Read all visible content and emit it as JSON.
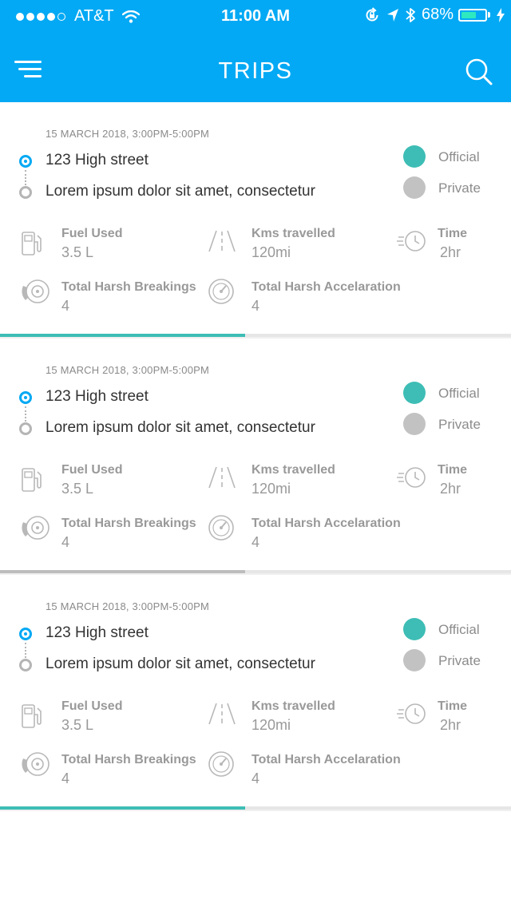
{
  "status_bar": {
    "carrier": "AT&T",
    "time": "11:00 AM",
    "battery": "68%",
    "battery_level": 0.68,
    "signal_bars": 4,
    "icons": [
      "wifi-icon",
      "rotation-lock-icon",
      "location-arrow-icon",
      "bluetooth-icon",
      "battery-icon",
      "charging-bolt-icon"
    ]
  },
  "header": {
    "title": "TRIPS",
    "menu_icon": "menu-icon",
    "search_icon": "search-icon"
  },
  "colors": {
    "primary": "#03a9f4",
    "official": "#3dbdb5",
    "private": "#c2c2c2",
    "text_muted": "#999999"
  },
  "trips": [
    {
      "date": "15 MARCH 2018, 3:00PM-5:00PM",
      "from": "123 High street",
      "to": "Lorem ipsum dolor sit amet, consectetur",
      "categories": {
        "official": "Official",
        "private": "Private"
      },
      "stats": {
        "fuel": {
          "label": "Fuel Used",
          "value": "3.5 L",
          "icon": "fuel-pump-icon"
        },
        "kms": {
          "label": "Kms travelled",
          "value": "120mi",
          "icon": "road-icon"
        },
        "time": {
          "label": "Time",
          "value": "2hr",
          "icon": "fast-clock-icon"
        },
        "braking": {
          "label": "Total Harsh Breakings",
          "value": "4",
          "icon": "brake-disc-icon"
        },
        "accel": {
          "label": "Total Harsh Accelaration",
          "value": "4",
          "icon": "speedometer-icon"
        }
      },
      "progress": 0.48,
      "progress_color": "#3dbdb5"
    },
    {
      "date": "15 MARCH 2018, 3:00PM-5:00PM",
      "from": "123 High street",
      "to": "Lorem ipsum dolor sit amet, consectetur",
      "categories": {
        "official": "Official",
        "private": "Private"
      },
      "stats": {
        "fuel": {
          "label": "Fuel Used",
          "value": "3.5 L",
          "icon": "fuel-pump-icon"
        },
        "kms": {
          "label": "Kms travelled",
          "value": "120mi",
          "icon": "road-icon"
        },
        "time": {
          "label": "Time",
          "value": "2hr",
          "icon": "fast-clock-icon"
        },
        "braking": {
          "label": "Total Harsh Breakings",
          "value": "4",
          "icon": "brake-disc-icon"
        },
        "accel": {
          "label": "Total Harsh Accelaration",
          "value": "4",
          "icon": "speedometer-icon"
        }
      },
      "progress": 0.48,
      "progress_color": "#bdbdbd"
    },
    {
      "date": "15 MARCH 2018, 3:00PM-5:00PM",
      "from": "123 High street",
      "to": "Lorem ipsum dolor sit amet, consectetur",
      "categories": {
        "official": "Official",
        "private": "Private"
      },
      "stats": {
        "fuel": {
          "label": "Fuel Used",
          "value": "3.5 L",
          "icon": "fuel-pump-icon"
        },
        "kms": {
          "label": "Kms travelled",
          "value": "120mi",
          "icon": "road-icon"
        },
        "time": {
          "label": "Time",
          "value": "2hr",
          "icon": "fast-clock-icon"
        },
        "braking": {
          "label": "Total Harsh Breakings",
          "value": "4",
          "icon": "brake-disc-icon"
        },
        "accel": {
          "label": "Total Harsh Accelaration",
          "value": "4",
          "icon": "speedometer-icon"
        }
      },
      "progress": 0.48,
      "progress_color": "#3dbdb5"
    }
  ]
}
